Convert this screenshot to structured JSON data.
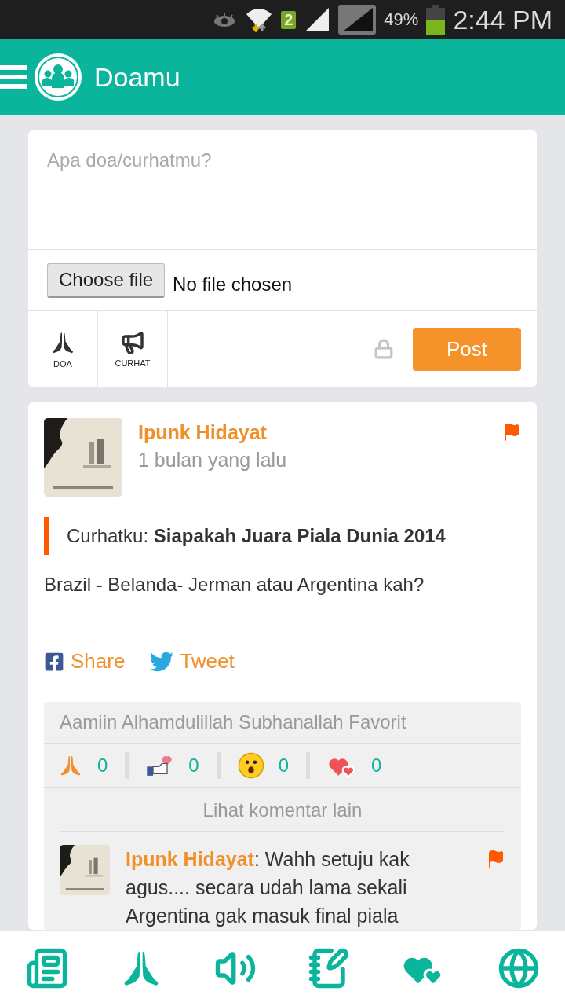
{
  "status_bar": {
    "sim_badge": "2",
    "battery": "49%",
    "time": "2:44 PM"
  },
  "app_bar": {
    "title": "Doamu"
  },
  "composer": {
    "placeholder": "Apa doa/curhatmu?",
    "file_button": "Choose file",
    "file_status": "No file chosen",
    "types": [
      {
        "kind": "doa",
        "label": "DOA"
      },
      {
        "kind": "curhat",
        "label": "CURHAT"
      }
    ],
    "private": false,
    "post_button": "Post"
  },
  "post": {
    "author": "Ipunk Hidayat",
    "time": "1 bulan yang lalu",
    "title": "Curhatku: **Siapakah Juara Piala Dunia 2014**",
    "body": "Brazil - Belanda- Jerman atau Argentina kah?",
    "share": [
      {
        "kind": "facebook",
        "label": "Share"
      },
      {
        "kind": "twitter",
        "label": "Tweet"
      }
    ],
    "reactions_header": "Aamiin Alhamdulillah Subhanallah Favorit",
    "reactions": [
      {
        "kind": "pray",
        "count": "0"
      },
      {
        "kind": "like",
        "count": "0"
      },
      {
        "kind": "wow",
        "count": "0"
      },
      {
        "kind": "love",
        "count": "0"
      }
    ],
    "more_comments": "Lihat komentar lain",
    "comments": [
      {
        "author": "Ipunk Hidayat",
        "text": ": Wahh setuju kak agus.... secara udah lama sekali Argentina gak masuk final piala"
      }
    ]
  },
  "bottom_nav": [
    {
      "kind": "news"
    },
    {
      "kind": "pray"
    },
    {
      "kind": "sound"
    },
    {
      "kind": "notes"
    },
    {
      "kind": "hearts"
    },
    {
      "kind": "globe"
    }
  ]
}
